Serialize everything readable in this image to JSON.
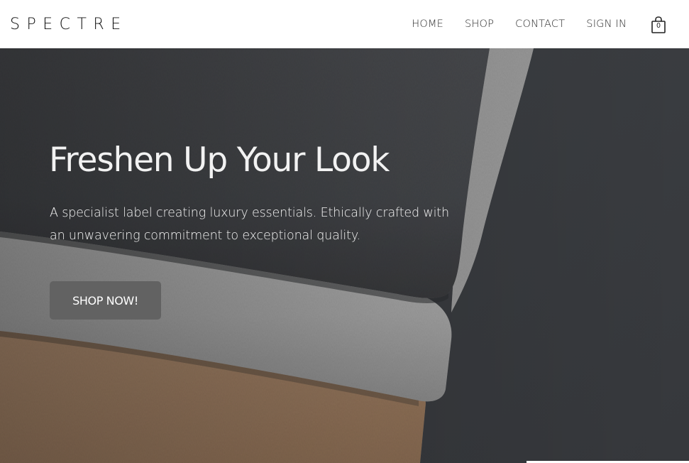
{
  "header": {
    "logo": "SPECTRE",
    "nav": [
      {
        "label": "HOME"
      },
      {
        "label": "SHOP"
      },
      {
        "label": "CONTACT"
      },
      {
        "label": "SIGN IN"
      }
    ],
    "cart_count": "0"
  },
  "hero": {
    "title": "Freshen Up Your Look",
    "subtitle": "A specialist label creating luxury essentials. Ethically crafted with an unwavering commitment to exceptional quality.",
    "cta_label": "SHOP NOW!"
  },
  "icons": {
    "cart": "shopping-bag-icon"
  },
  "colors": {
    "header_bg": "#ffffff",
    "button_bg": "#626262",
    "hero_text": "#f2f2f2",
    "nav_text": "#2b2b2b"
  }
}
